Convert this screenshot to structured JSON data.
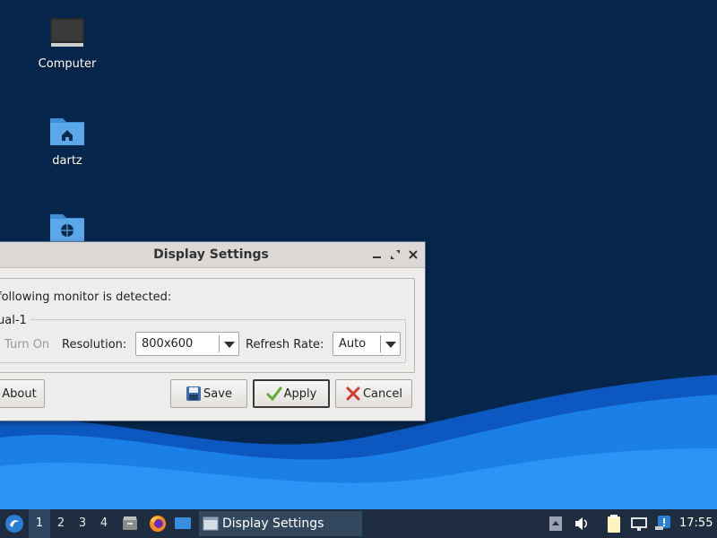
{
  "desktop": {
    "icons": [
      {
        "label": "Computer",
        "icon": "computer-icon"
      },
      {
        "label": "dartz",
        "icon": "home-folder-icon"
      },
      {
        "label": "",
        "icon": "network-folder-icon"
      }
    ],
    "background_color": "#07264c",
    "wave_colors": [
      "#0e5fc8",
      "#1a8df0",
      "#3aa8ff"
    ]
  },
  "dialog": {
    "title": "Display Settings",
    "detected_text": "following monitor is detected:",
    "monitor_name": "ual-1",
    "turn_on_label": "Turn On",
    "resolution_label": "Resolution:",
    "resolution_value": "800x600",
    "refresh_label": "Refresh Rate:",
    "refresh_value": "Auto",
    "buttons": {
      "about": "About",
      "save": "Save",
      "apply": "Apply",
      "cancel": "Cancel"
    }
  },
  "taskbar": {
    "workspaces": [
      "1",
      "2",
      "3",
      "4"
    ],
    "active_workspace": "1",
    "launchers": [
      "file-manager-icon",
      "firefox-icon",
      "desktop-icon"
    ],
    "task": {
      "label": "Display Settings",
      "icon": "window-icon"
    },
    "tray": [
      "tray-arrow-icon",
      "volume-icon",
      "clipboard-icon",
      "network-icon",
      "update-icon"
    ],
    "clock": "17:55"
  }
}
